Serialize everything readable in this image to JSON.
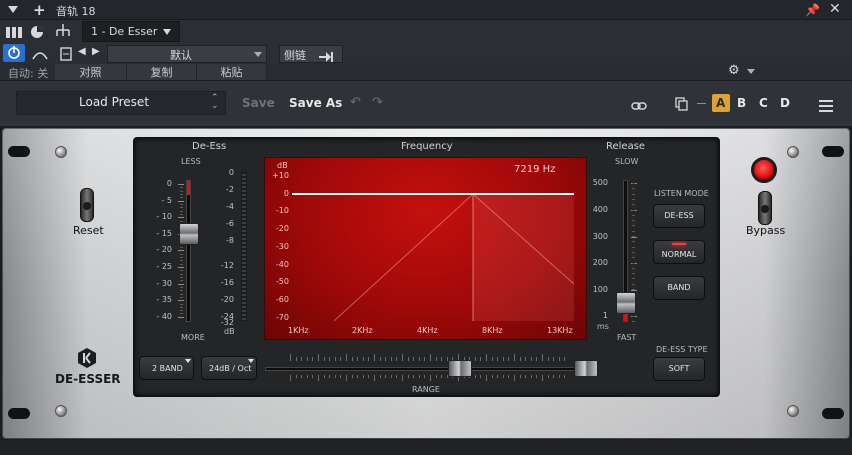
{
  "host": {
    "track_title": "音轨 18",
    "plugin_tab": "1 - De Esser",
    "preset_default": "默认",
    "sidechain_label": "侧链",
    "auto_label": "自动: 关",
    "compare_label": "对照",
    "copy_label": "复制",
    "paste_label": "粘贴"
  },
  "header": {
    "load_preset": "Load Preset",
    "save": "Save",
    "save_as": "Save As",
    "slots": [
      "A",
      "B",
      "C",
      "D"
    ],
    "active_slot": "A"
  },
  "plugin": {
    "brand": "DE-ESSER",
    "reset_label": "Reset",
    "bypass_label": "Bypass",
    "deess": {
      "title": "De-Ess",
      "top_label": "LESS",
      "bottom_label": "MORE",
      "scale": [
        "0",
        "- 5",
        "- 10",
        "- 15",
        "- 20",
        "- 25",
        "- 30",
        "- 35",
        "- 40"
      ],
      "value": -15
    },
    "meter": {
      "scale": [
        "0",
        "-2",
        "-4",
        "-6",
        "-8",
        "-12",
        "-16",
        "-20",
        "-24",
        "-32"
      ],
      "unit": "dB"
    },
    "frequency": {
      "title": "Frequency",
      "readout": "7219 Hz",
      "db_label": "dB",
      "y_labels": [
        "+10",
        "0",
        "-10",
        "-20",
        "-30",
        "-40",
        "-50",
        "-60",
        "-70"
      ],
      "x_labels": [
        "1KHz",
        "2KHz",
        "4KHz",
        "8KHz",
        "13KHz"
      ]
    },
    "release": {
      "title": "Release",
      "top_label": "SLOW",
      "bottom_label": "FAST",
      "unit": "ms",
      "scale": [
        "500",
        "400",
        "300",
        "200",
        "100",
        "1"
      ],
      "value": 50
    },
    "listen_mode": {
      "title": "LISTEN MODE",
      "buttons": [
        "DE-ESS",
        "NORMAL",
        "BAND"
      ],
      "active": "NORMAL"
    },
    "deess_type": {
      "title": "DE-ESS TYPE",
      "value": "SOFT"
    },
    "band_select": "2 BAND",
    "slope_select": "24dB / Oct",
    "range_label": "RANGE"
  }
}
